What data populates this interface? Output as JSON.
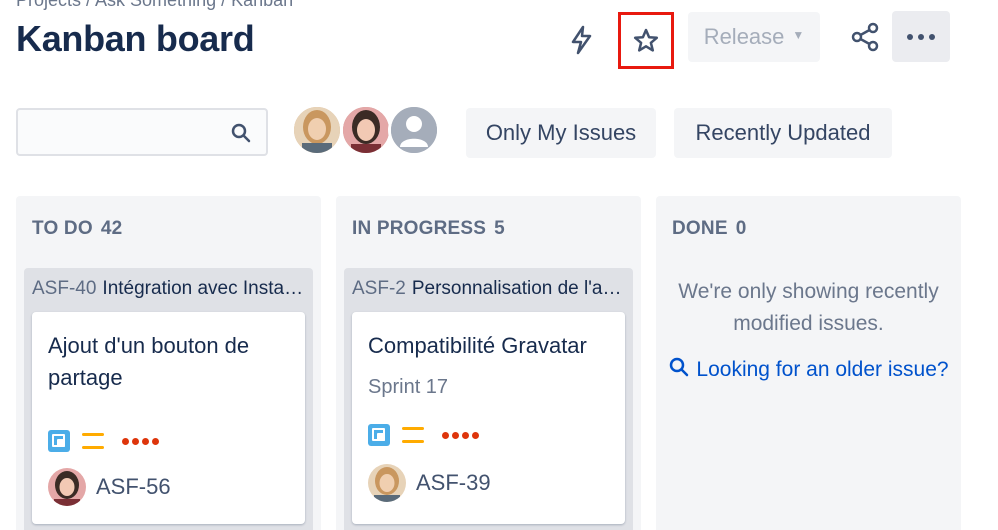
{
  "header": {
    "breadcrumb": "Projects / Ask Something / Kanban",
    "title": "Kanban board",
    "release_label": "Release"
  },
  "filters": {
    "search_placeholder": "",
    "only_my_issues": "Only My Issues",
    "recently_updated": "Recently Updated"
  },
  "columns": [
    {
      "name": "TO DO",
      "count": "42",
      "swimlane": {
        "key": "ASF-40",
        "title": "Intégration avec Instagram"
      },
      "card": {
        "title": "Ajout d'un bouton de partage",
        "sprint": "",
        "key": "ASF-56"
      }
    },
    {
      "name": "IN PROGRESS",
      "count": "5",
      "swimlane": {
        "key": "ASF-2",
        "title": "Personnalisation de l'avatar"
      },
      "card": {
        "title": "Compatibilité Gravatar",
        "sprint": "Sprint 17",
        "key": "ASF-39"
      }
    },
    {
      "name": "DONE",
      "count": "0",
      "message": "We're only showing recently modified issues.",
      "link": "Looking for an older issue?"
    }
  ],
  "colors": {
    "title": "#172b4d",
    "accent": "#0052cc",
    "highlight": "#e8190f",
    "column_bg": "#f4f5f7",
    "priority": "#ffab00",
    "story_dots": "#de350b",
    "issue_type": "#4bade8"
  },
  "icons": {
    "automation": "lightning-icon",
    "star": "star-icon",
    "share": "share-icon",
    "more": "more-icon",
    "search": "search-icon",
    "issue_type": "subtask-icon",
    "priority": "priority-medium-icon",
    "link": "magnify-icon"
  }
}
